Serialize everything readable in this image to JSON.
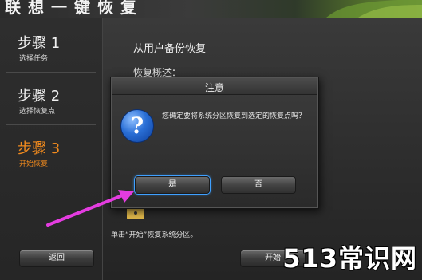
{
  "app": {
    "title": "联想一键恢复"
  },
  "sidebar": {
    "steps": [
      {
        "title": "步骤 1",
        "sub": "选择任务"
      },
      {
        "title": "步骤 2",
        "sub": "选择恢复点"
      },
      {
        "title": "步骤 3",
        "sub": "开始恢复"
      }
    ]
  },
  "content": {
    "title": "从用户备份恢复",
    "subtitle": "恢复概述：",
    "line2": "区。",
    "instruction": "单击“开始”恢复系统分区。",
    "back_label": "返回",
    "start_label": "开始"
  },
  "dialog": {
    "title": "注意",
    "message": "您确定要将系统分区恢复到选定的恢复点吗？",
    "yes_label": "是",
    "no_label": "否",
    "icon": "question-icon"
  },
  "colors": {
    "active_step": "#f08a1e",
    "arrow": "#e43ce0",
    "focus": "#3fa0ff"
  },
  "watermark": "513常识网"
}
